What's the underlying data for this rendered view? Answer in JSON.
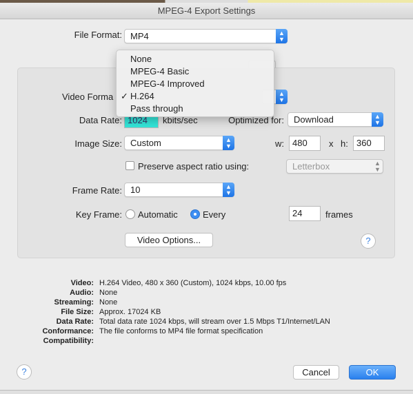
{
  "window": {
    "title": "MPEG-4 Export Settings"
  },
  "file_format": {
    "label": "File Format:",
    "value": "MP4"
  },
  "video_format": {
    "label": "Video Forma",
    "menu": [
      {
        "label": "None",
        "checked": false
      },
      {
        "label": "MPEG-4 Basic",
        "checked": false
      },
      {
        "label": "MPEG-4 Improved",
        "checked": false
      },
      {
        "label": "H.264",
        "checked": true
      },
      {
        "label": "Pass through",
        "checked": false
      }
    ],
    "check_glyph": "✓"
  },
  "data_rate": {
    "label": "Data Rate:",
    "value": "1024",
    "unit": "kbits/sec"
  },
  "optimized": {
    "label": "Optimized for:",
    "value": "Download"
  },
  "image_size": {
    "label": "Image Size:",
    "value": "Custom",
    "w_label": "w:",
    "w": "480",
    "x_label": "x",
    "h_label": "h:",
    "h": "360"
  },
  "aspect": {
    "label": "Preserve aspect ratio using:",
    "checked": false,
    "value": "Letterbox"
  },
  "frame_rate": {
    "label": "Frame Rate:",
    "value": "10"
  },
  "key_frame": {
    "label": "Key Frame:",
    "automatic": "Automatic",
    "every": "Every",
    "selected": "every",
    "value": "24",
    "unit": "frames"
  },
  "video_options_button": "Video Options...",
  "help": "?",
  "summary": [
    {
      "k": "Video:",
      "v": "H.264 Video, 480 x 360 (Custom), 1024 kbps, 10.00 fps"
    },
    {
      "k": "Audio:",
      "v": "None"
    },
    {
      "k": "Streaming:",
      "v": "None"
    },
    {
      "k": "File Size:",
      "v": "Approx. 17024 KB"
    },
    {
      "k": "Data Rate:",
      "v": "Total data rate 1024 kbps, will stream over 1.5 Mbps T1/Internet/LAN"
    },
    {
      "k": "Conformance:",
      "v": "The file conforms to MP4 file format specification"
    },
    {
      "k": "Compatibility:",
      "v": ""
    }
  ],
  "buttons": {
    "cancel": "Cancel",
    "ok": "OK"
  },
  "colors": {
    "accent": "#1e74e6",
    "data_rate_highlight": "#33e6d9"
  }
}
